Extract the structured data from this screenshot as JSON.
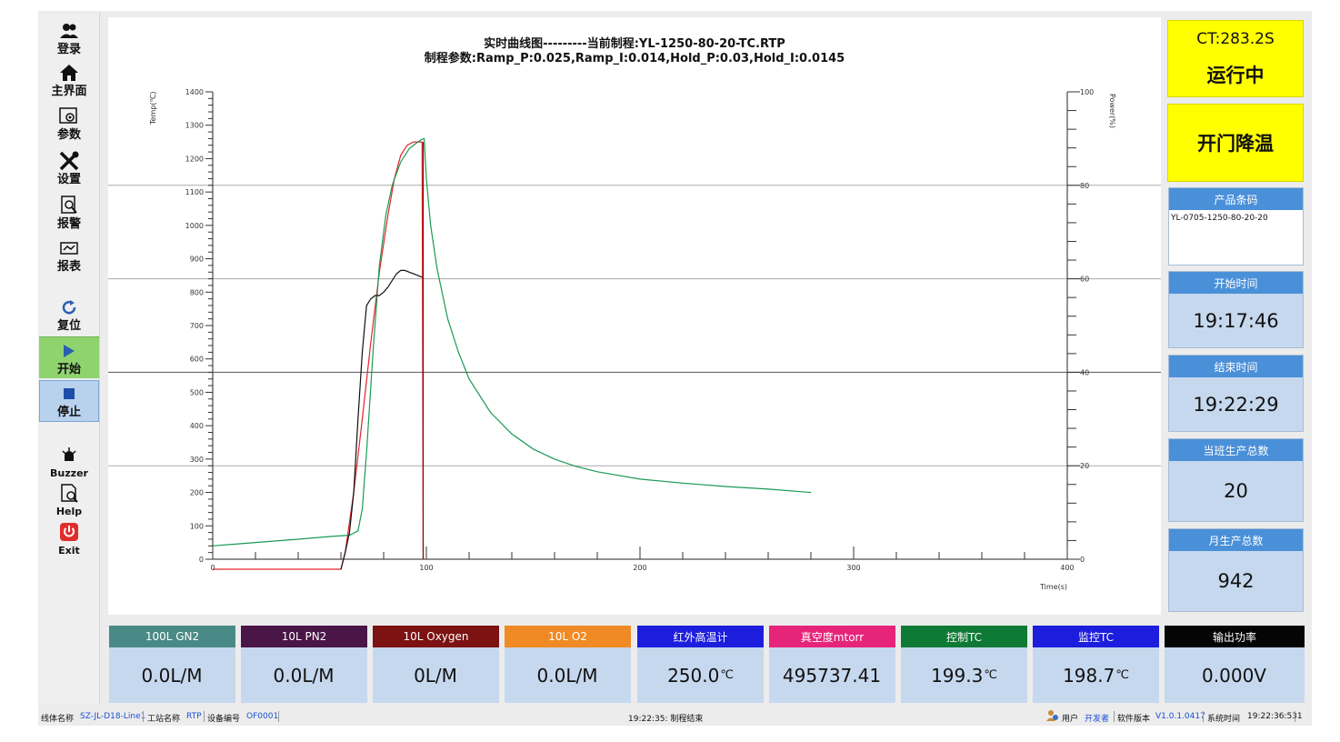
{
  "sidebar": {
    "items": [
      {
        "label": "登录",
        "icon": "users-icon"
      },
      {
        "label": "主界面",
        "icon": "home-icon"
      },
      {
        "label": "参数",
        "icon": "parameters-icon"
      },
      {
        "label": "设置",
        "icon": "tools-icon"
      },
      {
        "label": "报警",
        "icon": "alarm-report-icon"
      },
      {
        "label": "报表",
        "icon": "report-icon"
      },
      {
        "label": "复位",
        "icon": "reset-icon"
      },
      {
        "label": "开始",
        "icon": "play-icon"
      },
      {
        "label": "停止",
        "icon": "stop-icon"
      },
      {
        "label": "Buzzer",
        "icon": "buzzer-icon"
      },
      {
        "label": "Help",
        "icon": "help-icon"
      },
      {
        "label": "Exit",
        "icon": "power-icon"
      }
    ]
  },
  "chart": {
    "title_line1": "实时曲线图---------当前制程:YL-1250-80-20-TC.RTP",
    "title_line2": "制程参数:Ramp_P:0.025,Ramp_I:0.014,Hold_P:0.03,Hold_I:0.0145"
  },
  "chart_data": {
    "type": "line",
    "xlabel": "Time(s)",
    "ylabel": "Temp(℃)",
    "y2label": "Power(%)",
    "xlim": [
      0,
      400
    ],
    "ylim": [
      0,
      1400
    ],
    "y2lim": [
      0,
      100
    ],
    "x_ticks": [
      "0",
      "100",
      "200",
      "300",
      "400"
    ],
    "y_ticks": [
      "0",
      "100",
      "200",
      "300",
      "400",
      "500",
      "600",
      "700",
      "800",
      "900",
      "1000",
      "1100",
      "1200",
      "1300",
      "1400"
    ],
    "y2_ticks": [
      "0",
      "20",
      "40",
      "60",
      "80",
      "100"
    ],
    "grid": "horizontal at power 20, 40, 60, 80",
    "series": [
      {
        "color": "#e0242a",
        "axis": "temp",
        "x": [
          0,
          60,
          62,
          66,
          70,
          74,
          78,
          82,
          85,
          88,
          91,
          94,
          97,
          98,
          98.5
        ],
        "y": [
          -30,
          -30,
          20,
          200,
          420,
          650,
          860,
          1030,
          1140,
          1210,
          1240,
          1250,
          1250,
          1250,
          0
        ]
      },
      {
        "color": "#1a9a55",
        "axis": "temp",
        "x": [
          0,
          20,
          40,
          55,
          64,
          68,
          70,
          72,
          75,
          78,
          81,
          84,
          88,
          92,
          96,
          98,
          99,
          100,
          102,
          105,
          110,
          115,
          120,
          130,
          140,
          150,
          160,
          170,
          180,
          200,
          220,
          240,
          260,
          280
        ],
        "y": [
          40,
          50,
          60,
          68,
          72,
          85,
          150,
          320,
          620,
          880,
          1030,
          1120,
          1190,
          1230,
          1250,
          1258,
          1260,
          1140,
          1000,
          870,
          720,
          620,
          540,
          440,
          375,
          330,
          300,
          278,
          262,
          240,
          228,
          218,
          210,
          200
        ]
      },
      {
        "color": "#111111",
        "axis": "temp",
        "x": [
          60,
          62,
          64,
          66,
          68,
          70,
          72,
          74,
          76,
          78,
          80,
          82,
          84,
          86,
          88,
          90,
          92,
          94,
          96,
          98
        ],
        "y": [
          -30,
          20,
          80,
          200,
          420,
          620,
          760,
          780,
          790,
          790,
          800,
          815,
          835,
          855,
          865,
          865,
          860,
          855,
          850,
          845
        ]
      },
      {
        "color": "#7a0d12",
        "axis": "temp",
        "x": [
          98.5,
          98.5
        ],
        "y": [
          1250,
          0
        ]
      }
    ]
  },
  "right": {
    "ct": "CT:283.2S",
    "status": "运行中",
    "door": "开门降温",
    "product_code_label": "产品条码",
    "product_code": "YL-0705-1250-80-20-20",
    "start_label": "开始时间",
    "start_time": "19:17:46",
    "end_label": "结束时间",
    "end_time": "19:22:29",
    "shift_label": "当班生产总数",
    "shift_total": "20",
    "month_label": "月生产总数",
    "month_total": "942"
  },
  "colors": {
    "yellow": "#ffff00",
    "info_head": "#4a90d9",
    "panel_bg": "#c6d8ee"
  },
  "gauges": [
    {
      "label": "100L GN2",
      "value": "0.0L/M",
      "unit": "",
      "color": "#4a8a86"
    },
    {
      "label": "10L PN2",
      "value": "0.0L/M",
      "unit": "",
      "color": "#4a1547"
    },
    {
      "label": "10L Oxygen",
      "value": "0L/M",
      "unit": "",
      "color": "#7c1212"
    },
    {
      "label": "10L O2",
      "value": "0.0L/M",
      "unit": "",
      "color": "#f08a24"
    },
    {
      "label": "红外高温计",
      "value": "250.0",
      "unit": "℃",
      "color": "#1d1dde"
    },
    {
      "label": "真空度mtorr",
      "value": "495737.41",
      "unit": "",
      "color": "#e6247a"
    },
    {
      "label": "控制TC",
      "value": "199.3",
      "unit": "℃",
      "color": "#0e7a36"
    },
    {
      "label": "监控TC",
      "value": "198.7",
      "unit": "℃",
      "color": "#1d1dde"
    },
    {
      "label": "输出功率",
      "value": "0.000V",
      "unit": "",
      "color": "#050505"
    }
  ],
  "statusbar": {
    "line_label": "线体名称",
    "line_value": "SZ-JL-D18-Line1",
    "station_label": "工站名称",
    "station_value": "RTP",
    "device_label": "设备编号",
    "device_value": "OF0001",
    "message": "19:22:35: 制程结束",
    "user_label": "用户",
    "user_value": "开发者",
    "version_label": "软件版本",
    "version_value": "V1.0.1.0417",
    "systime_label": "系统时间",
    "systime_value": "19:22:36:531"
  }
}
